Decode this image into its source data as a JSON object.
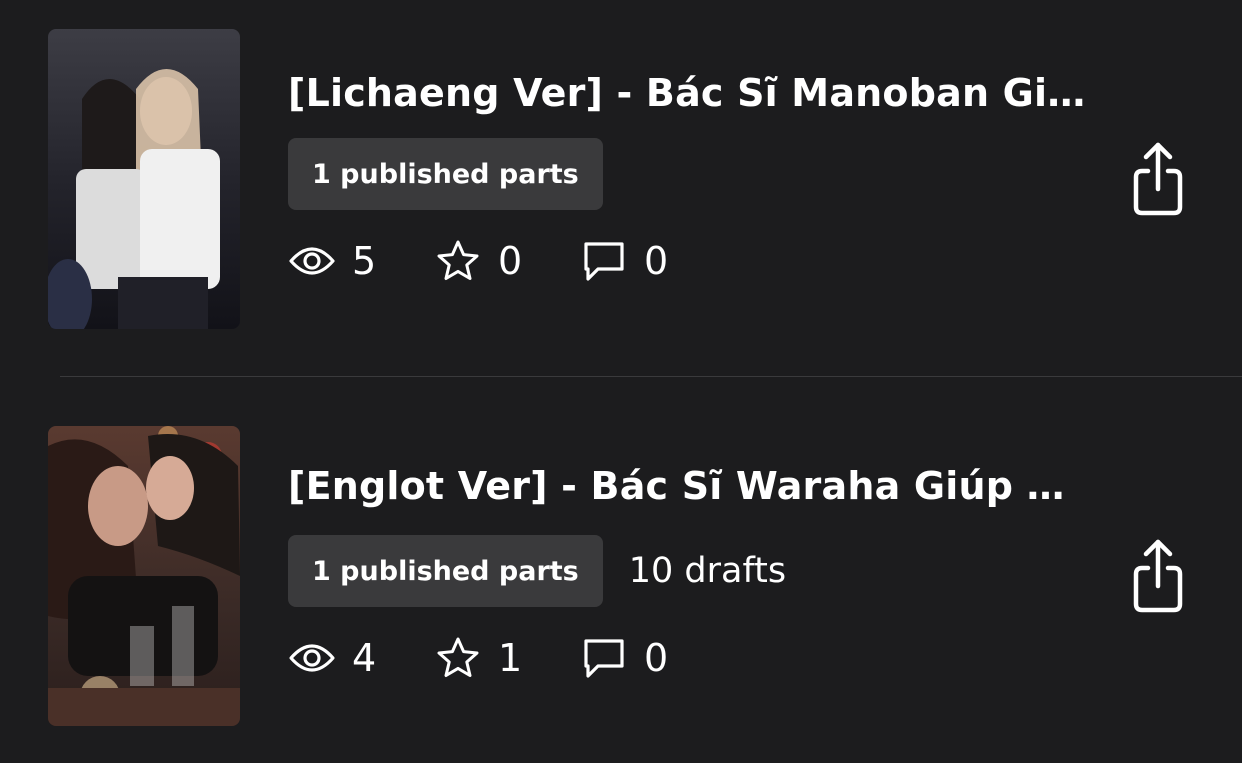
{
  "stories": [
    {
      "title": "[Lichaeng Ver] - Bác Sĩ Manoban Giúp Em",
      "published_badge": "1 published parts",
      "drafts": "",
      "stats": {
        "views": "5",
        "votes": "0",
        "comments": "0"
      },
      "cover_icon": "cover-image-photo"
    },
    {
      "title": "[Englot Ver] - Bác Sĩ Waraha Giúp Em",
      "published_badge": "1 published parts",
      "drafts": "10 drafts",
      "stats": {
        "views": "4",
        "votes": "1",
        "comments": "0"
      },
      "cover_icon": "cover-image-photo"
    }
  ],
  "icons": {
    "views": "eye-icon",
    "votes": "star-icon",
    "comments": "comment-icon",
    "share": "share-icon"
  },
  "colors": {
    "background": "#1c1c1e",
    "badge": "#3a3a3c",
    "text": "#ffffff"
  }
}
